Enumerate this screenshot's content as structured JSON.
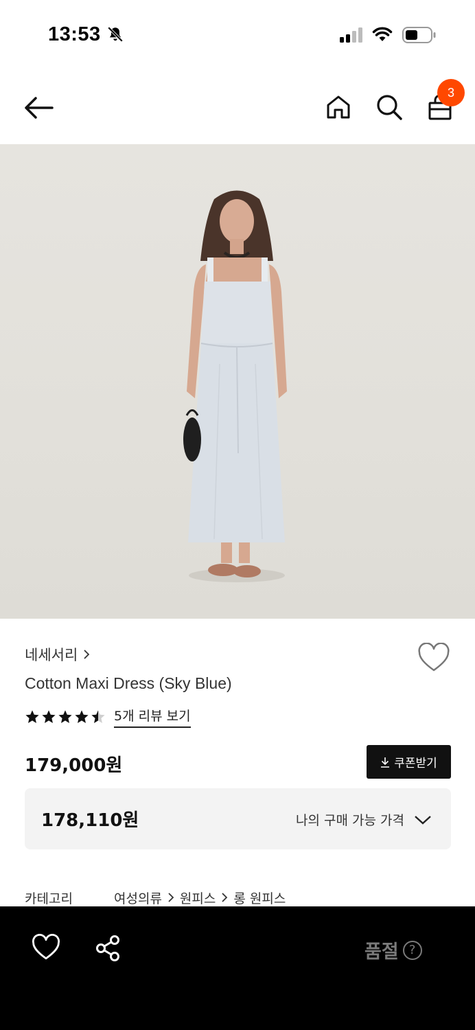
{
  "status_bar": {
    "time": "13:53"
  },
  "header": {
    "cart_count": "3"
  },
  "product": {
    "brand": "네세서리",
    "name": "Cotton Maxi Dress (Sky Blue)",
    "rating": 4.5,
    "review_link": "5개 리뷰 보기",
    "price": "179,000원",
    "coupon_label": "쿠폰받기",
    "my_price": "178,110원",
    "my_price_label": "나의 구매 가능 가격",
    "category_label": "카테고리",
    "category_path": [
      "여성의류",
      "원피스",
      "롱 원피스"
    ]
  },
  "bottom_bar": {
    "status_label": "품절",
    "help_symbol": "?"
  },
  "colors": {
    "badge": "#ff4800",
    "bottom_bar": "#000000",
    "soldout_text": "#7a7a7a"
  }
}
